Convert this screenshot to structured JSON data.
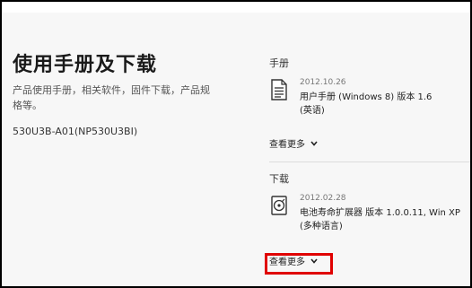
{
  "page": {
    "title": "使用手册及下载",
    "description": "产品使用手册，相关软件，固件下载，产品规格等。",
    "model": "530U3B-A01(NP530U3BI)"
  },
  "manuals": {
    "label": "手册",
    "item": {
      "icon": "document-icon",
      "date": "2012.10.26",
      "name_line1": "用户手册 (Windows 8)  版本 1.6",
      "name_line2": "(英语)"
    },
    "more_label": "查看更多"
  },
  "downloads": {
    "label": "下载",
    "item": {
      "icon": "disc-icon",
      "date": "2012.02.28",
      "name_line1": "电池寿命扩展器  版本 1.0.0.11, Win XP",
      "name_line2": "(多种语言)"
    },
    "more_label": "查看更多"
  },
  "colors": {
    "highlight": "#e00000",
    "background": "#f7f7f7"
  }
}
